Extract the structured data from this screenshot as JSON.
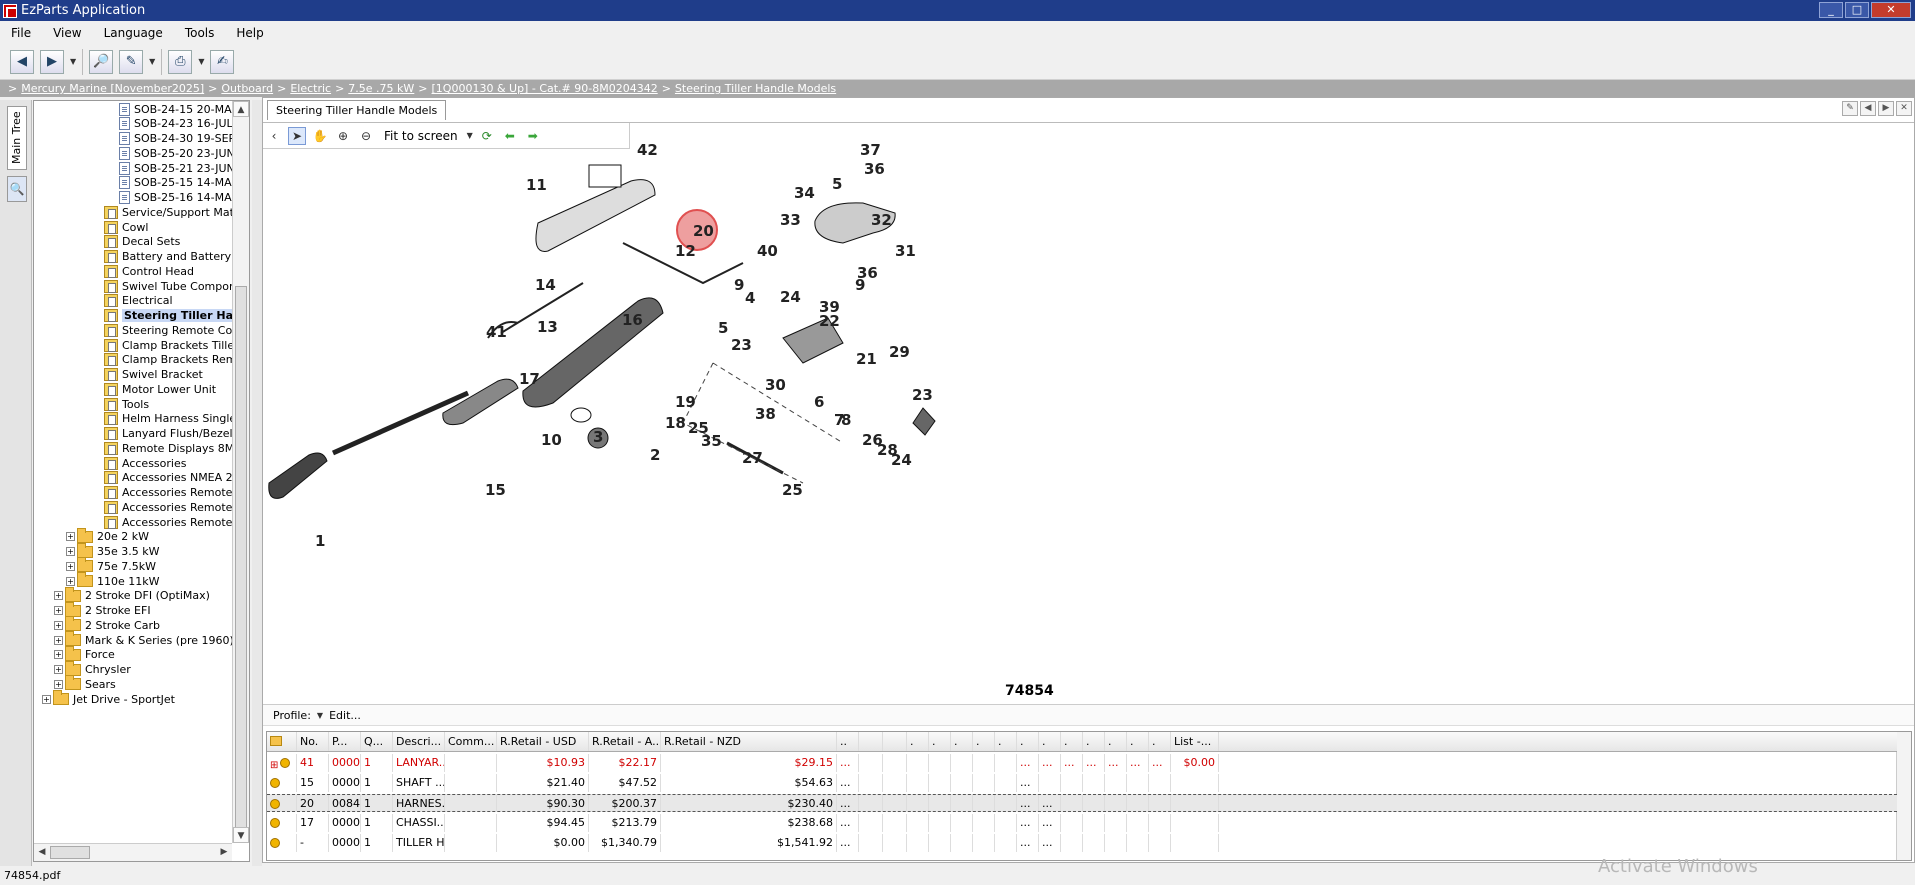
{
  "window": {
    "title": "EzParts Application"
  },
  "menu": [
    "File",
    "View",
    "Language",
    "Tools",
    "Help"
  ],
  "breadcrumb": [
    {
      "label": "Mercury Marine [November2025]",
      "link": true
    },
    {
      "label": "Outboard",
      "link": true
    },
    {
      "label": "Electric",
      "link": true
    },
    {
      "label": "7.5e .75  kW",
      "link": true
    },
    {
      "label": "[1Q000130 & Up] - Cat.# 90-8M0204342",
      "link": true
    },
    {
      "label": "Steering Tiller Handle Models",
      "link": true
    }
  ],
  "sidebar": {
    "tab_label": "Main Tree",
    "search_glyph": "🔍"
  },
  "tree": [
    {
      "label": "SOB-24-15 20-MA",
      "indent": 85,
      "icon": "doc"
    },
    {
      "label": "SOB-24-23 16-JUL",
      "indent": 85,
      "icon": "doc"
    },
    {
      "label": "SOB-24-30 19-SEP",
      "indent": 85,
      "icon": "doc"
    },
    {
      "label": "SOB-25-20 23-JUN",
      "indent": 85,
      "icon": "doc"
    },
    {
      "label": "SOB-25-21 23-JUN",
      "indent": 85,
      "icon": "doc"
    },
    {
      "label": "SOB-25-15 14-MA",
      "indent": 85,
      "icon": "doc"
    },
    {
      "label": "SOB-25-16 14-MA",
      "indent": 85,
      "icon": "doc"
    },
    {
      "label": "Service/Support Mate",
      "indent": 70,
      "icon": "pdoc"
    },
    {
      "label": "Cowl",
      "indent": 70,
      "icon": "pdoc"
    },
    {
      "label": "Decal Sets",
      "indent": 70,
      "icon": "pdoc"
    },
    {
      "label": "Battery and Battery C",
      "indent": 70,
      "icon": "pdoc"
    },
    {
      "label": "Control Head",
      "indent": 70,
      "icon": "pdoc"
    },
    {
      "label": "Swivel Tube Compone",
      "indent": 70,
      "icon": "pdoc"
    },
    {
      "label": "Electrical",
      "indent": 70,
      "icon": "pdoc"
    },
    {
      "label": "Steering Tiller Han",
      "indent": 70,
      "icon": "pdoc",
      "selected": true
    },
    {
      "label": "Steering Remote Con",
      "indent": 70,
      "icon": "pdoc"
    },
    {
      "label": "Clamp Brackets Tiller",
      "indent": 70,
      "icon": "pdoc"
    },
    {
      "label": "Clamp Brackets Remo",
      "indent": 70,
      "icon": "pdoc"
    },
    {
      "label": "Swivel Bracket",
      "indent": 70,
      "icon": "pdoc"
    },
    {
      "label": "Motor Lower Unit",
      "indent": 70,
      "icon": "pdoc"
    },
    {
      "label": "Tools",
      "indent": 70,
      "icon": "pdoc"
    },
    {
      "label": "Helm Harness Single C",
      "indent": 70,
      "icon": "pdoc"
    },
    {
      "label": "Lanyard Flush/Bezel M",
      "indent": 70,
      "icon": "pdoc"
    },
    {
      "label": "Remote Displays 8M0",
      "indent": 70,
      "icon": "pdoc"
    },
    {
      "label": "Accessories",
      "indent": 70,
      "icon": "pdoc"
    },
    {
      "label": "Accessories NMEA 2K",
      "indent": 70,
      "icon": "pdoc"
    },
    {
      "label": "Accessories Remote C",
      "indent": 70,
      "icon": "pdoc"
    },
    {
      "label": "Accessories Remote C",
      "indent": 70,
      "icon": "pdoc"
    },
    {
      "label": "Accessories Remote C",
      "indent": 70,
      "icon": "pdoc"
    },
    {
      "label": "20e 2  kW",
      "indent": 32,
      "icon": "folder",
      "expander": "+"
    },
    {
      "label": "35e 3.5 kW",
      "indent": 32,
      "icon": "folder",
      "expander": "+"
    },
    {
      "label": "75e 7.5kW",
      "indent": 32,
      "icon": "folder",
      "expander": "+"
    },
    {
      "label": "110e 11kW",
      "indent": 32,
      "icon": "folder",
      "expander": "+"
    },
    {
      "label": "2 Stroke DFI (OptiMax)",
      "indent": 20,
      "icon": "folder",
      "expander": "+"
    },
    {
      "label": "2 Stroke EFI",
      "indent": 20,
      "icon": "folder",
      "expander": "+"
    },
    {
      "label": "2 Stroke Carb",
      "indent": 20,
      "icon": "folder",
      "expander": "+"
    },
    {
      "label": "Mark & K Series (pre 1960)",
      "indent": 20,
      "icon": "folder",
      "expander": "+"
    },
    {
      "label": "Force",
      "indent": 20,
      "icon": "folder",
      "expander": "+"
    },
    {
      "label": "Chrysler",
      "indent": 20,
      "icon": "folder",
      "expander": "+"
    },
    {
      "label": "Sears",
      "indent": 20,
      "icon": "folder",
      "expander": "+"
    },
    {
      "label": "Jet Drive - SportJet",
      "indent": 8,
      "icon": "folder",
      "expander": "+"
    }
  ],
  "document": {
    "tab_label": "Steering Tiller Handle Models",
    "fit_label": "Fit to screen",
    "catalog_number": "74854",
    "callouts": [
      "42",
      "11",
      "20",
      "12",
      "14",
      "13",
      "9",
      "4",
      "16",
      "5",
      "41",
      "17",
      "19",
      "18",
      "10",
      "3",
      "2",
      "15",
      "1",
      "40",
      "24",
      "23",
      "39",
      "22",
      "37",
      "36",
      "5",
      "34",
      "33",
      "32",
      "31",
      "36",
      "9",
      "21",
      "29",
      "30",
      "6",
      "7",
      "8",
      "23",
      "26",
      "28",
      "24",
      "25",
      "35",
      "38",
      "27",
      "25"
    ],
    "highlighted_callout": "20"
  },
  "profile": {
    "label": "Profile:",
    "edit_label": "Edit..."
  },
  "grid": {
    "columns": [
      "",
      "No.",
      "P...",
      "Q...",
      "Descri...",
      "Comm...",
      "R.Retail - USD",
      "R.Retail - A...",
      "R.Retail - NZD",
      "..",
      "",
      "",
      ".",
      ".",
      ".",
      ".",
      ".",
      ".",
      ".",
      ".",
      ".",
      ".",
      ".",
      ".",
      "List -..."
    ],
    "rows": [
      {
        "no": "41",
        "p": "0000",
        "q": "1",
        "desc": "LANYAR...",
        "comm": "",
        "usd": "$10.93",
        "aud": "$22.17",
        "nzd": "$29.15",
        "more": "...",
        "list": "$0.00",
        "red": true,
        "expander": true,
        "right_dots": [
          "...",
          "...",
          "...",
          "...",
          "...",
          "...",
          "..."
        ]
      },
      {
        "no": "15",
        "p": "0000",
        "q": "1",
        "desc": "SHAFT ...",
        "comm": "",
        "usd": "$21.40",
        "aud": "$47.52",
        "nzd": "$54.63",
        "more": "...",
        "list": "",
        "red": false,
        "expander": false,
        "right_dots": [
          "..."
        ]
      },
      {
        "no": "20",
        "p": "0084",
        "q": "1",
        "desc": "HARNES...",
        "comm": "",
        "usd": "$90.30",
        "aud": "$200.37",
        "nzd": "$230.40",
        "more": "...",
        "list": "",
        "red": false,
        "selected": true,
        "expander": false,
        "right_dots": [
          "...",
          "..."
        ]
      },
      {
        "no": "17",
        "p": "0000",
        "q": "1",
        "desc": "CHASSI...",
        "comm": "",
        "usd": "$94.45",
        "aud": "$213.79",
        "nzd": "$238.68",
        "more": "...",
        "list": "",
        "red": false,
        "expander": false,
        "right_dots": [
          "...",
          "..."
        ]
      },
      {
        "no": "-",
        "p": "0000",
        "q": "1",
        "desc": "TILLER H...",
        "comm": "",
        "usd": "$0.00",
        "aud": "$1,340.79",
        "nzd": "$1,541.92",
        "more": "...",
        "list": "",
        "red": false,
        "expander": false,
        "right_dots": [
          "...",
          "..."
        ]
      }
    ]
  },
  "status": {
    "text": "74854.pdf"
  },
  "watermark": "Activate Windows",
  "colors": {
    "titlebar": "#1f3d8a",
    "breadcrumb": "#a8a8a8",
    "highlight": "#e05050",
    "row_red": "#d00000"
  }
}
